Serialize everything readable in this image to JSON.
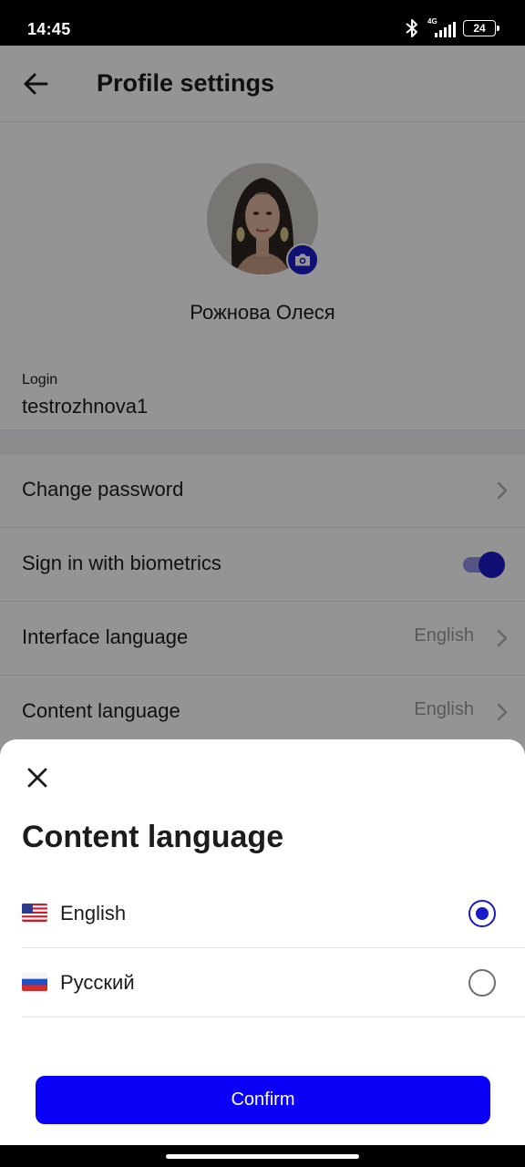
{
  "status_bar": {
    "time": "14:45",
    "network": "4G",
    "battery": "24"
  },
  "header": {
    "title": "Profile settings"
  },
  "profile": {
    "name": "Рожнова Олеся",
    "login_label": "Login",
    "login_value": "testrozhnova1"
  },
  "settings": {
    "change_password": "Change password",
    "biometrics": {
      "label": "Sign in with biometrics",
      "enabled": true
    },
    "interface_language": {
      "label": "Interface language",
      "value": "English"
    },
    "content_language": {
      "label": "Content language",
      "value": "English"
    }
  },
  "sheet": {
    "title": "Content language",
    "options": [
      {
        "label": "English",
        "flag": "us-flag",
        "selected": true
      },
      {
        "label": "Русский",
        "flag": "ru-flag",
        "selected": false
      }
    ],
    "confirm_label": "Confirm"
  },
  "colors": {
    "accent": "#1A1AC9",
    "confirm_button": "#0A00F5",
    "toggle_track": "#9090E6"
  }
}
